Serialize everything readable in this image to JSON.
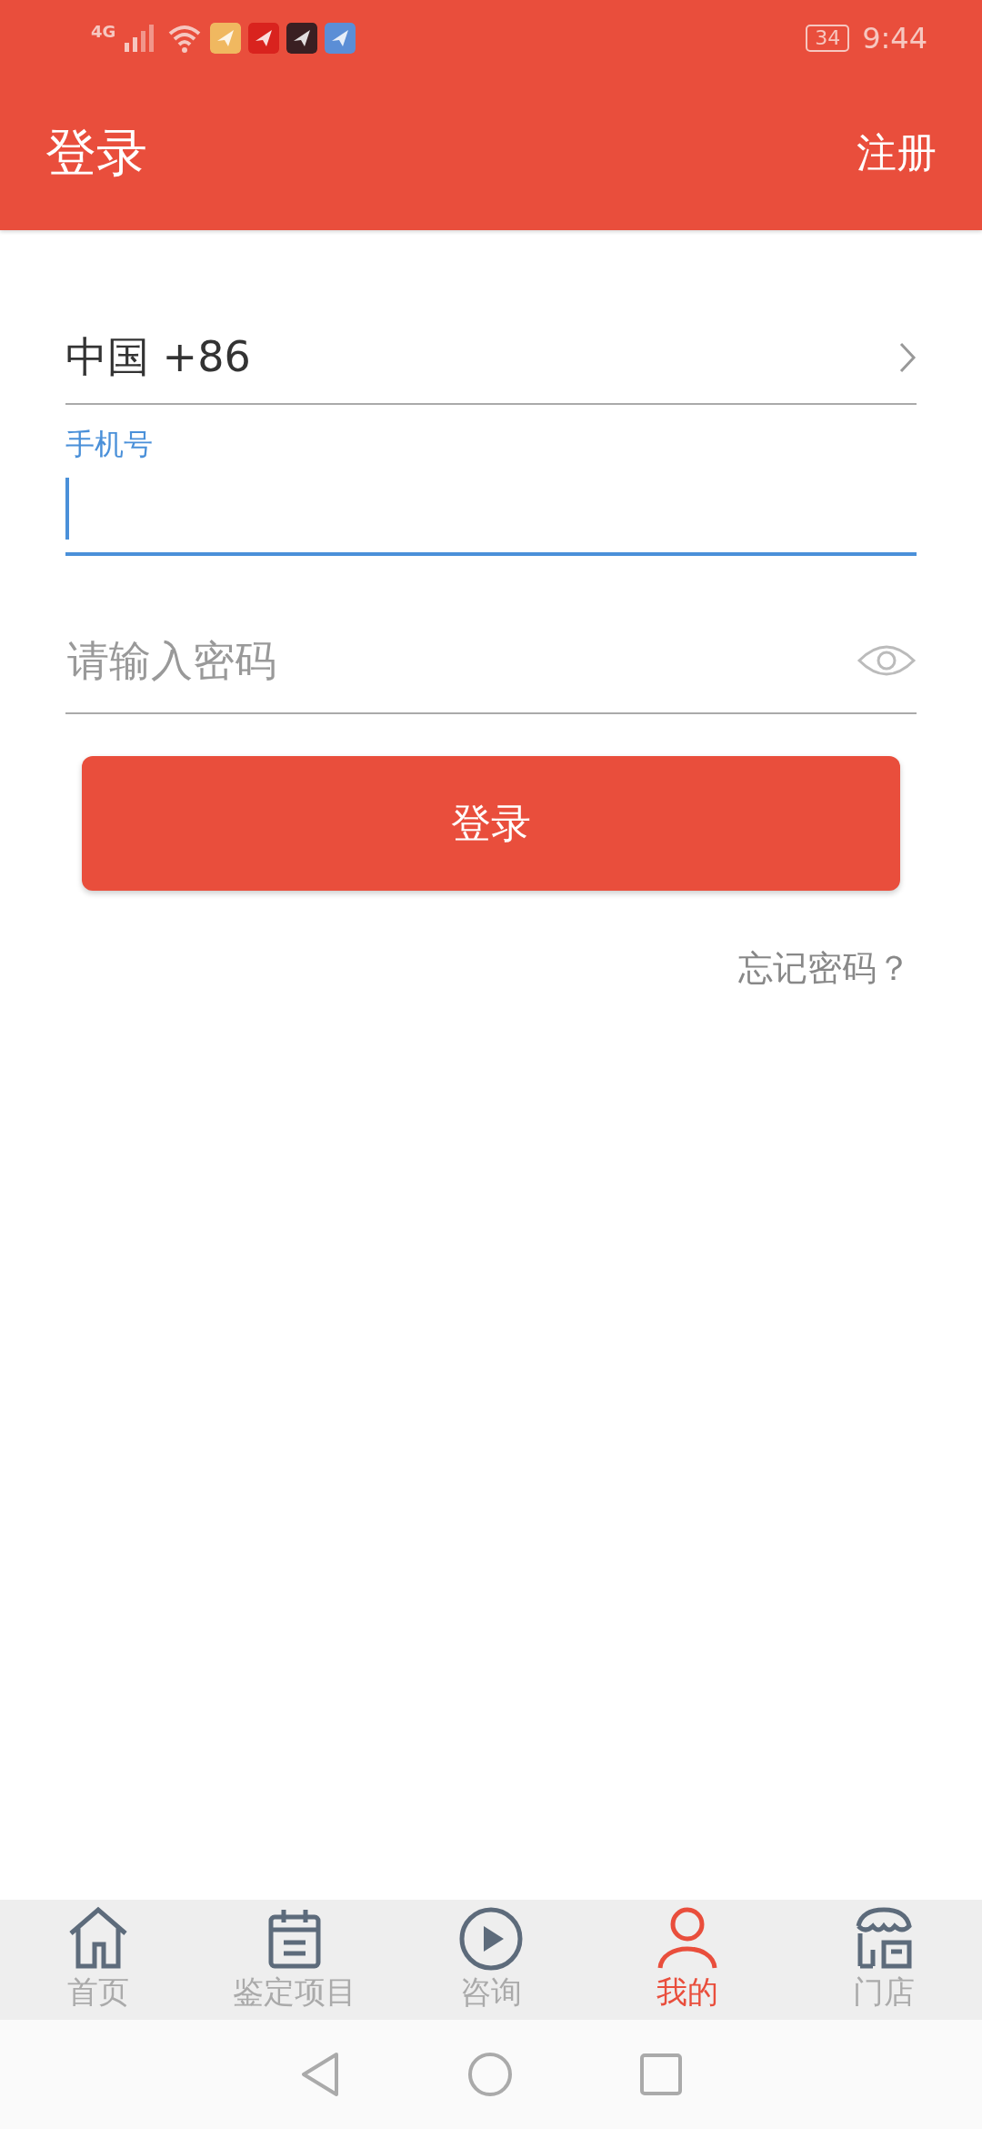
{
  "status_bar": {
    "network": "4G",
    "battery": "34",
    "time": "9:44"
  },
  "header": {
    "title": "登录",
    "action": "注册"
  },
  "country": {
    "value": "中国 +86"
  },
  "phone": {
    "label": "手机号",
    "focused": true
  },
  "password": {
    "placeholder": "请输入密码"
  },
  "login_button": "登录",
  "forgot_link": "忘记密码？",
  "tabs": [
    {
      "label": "首页",
      "selected": false
    },
    {
      "label": "鉴定项目",
      "selected": false
    },
    {
      "label": "咨询",
      "selected": false
    },
    {
      "label": "我的",
      "selected": true
    },
    {
      "label": "门店",
      "selected": false
    }
  ]
}
